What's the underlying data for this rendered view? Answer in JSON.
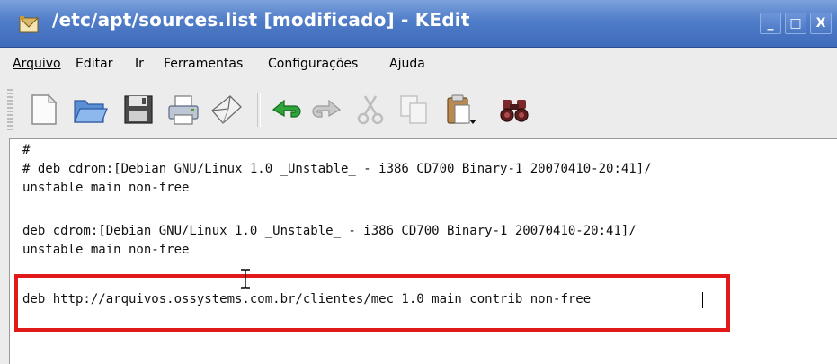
{
  "window": {
    "title": "/etc/apt/sources.list [modificado] - KEdit",
    "controls": [
      "_",
      "□",
      "X"
    ]
  },
  "menubar": {
    "items": [
      "Arquivo",
      "Editar",
      "Ir",
      "Ferramentas",
      "Configurações",
      "Ajuda"
    ]
  },
  "toolbar": {
    "buttons": [
      "new-file-icon",
      "open-folder-icon",
      "save-icon",
      "print-icon",
      "send-mail-icon",
      "undo-icon",
      "redo-icon",
      "cut-icon",
      "copy-icon",
      "paste-icon",
      "find-binoculars-icon"
    ]
  },
  "editor": {
    "lines": [
      "#",
      "# deb cdrom:[Debian GNU/Linux 1.0 _Unstable_ - i386 CD700 Binary-1 20070410-20:41]/",
      "unstable main non-free",
      "",
      "deb cdrom:[Debian GNU/Linux 1.0 _Unstable_ - i386 CD700 Binary-1 20070410-20:41]/",
      "unstable main non-free",
      "",
      "deb http://arquivos.ossystems.com.br/clientes/mec 1.0 main contrib non-free"
    ]
  },
  "colors": {
    "titlebar": "#4f7cc8",
    "highlight_border": "#e11919"
  }
}
